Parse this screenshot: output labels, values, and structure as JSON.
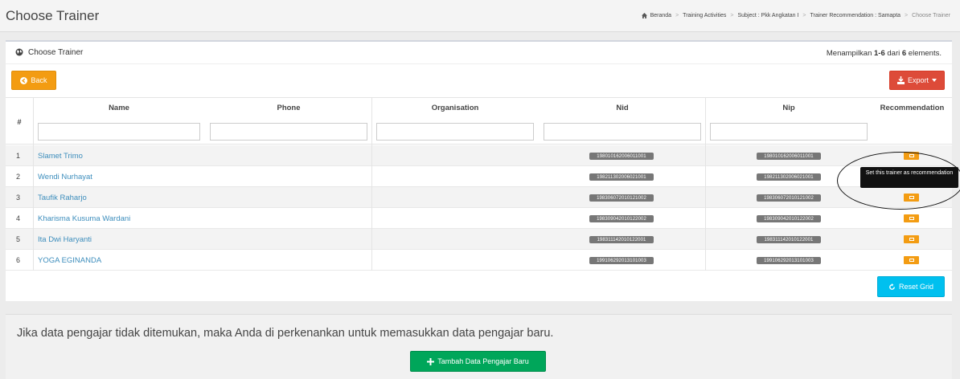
{
  "header": {
    "title": "Choose Trainer",
    "breadcrumb": [
      {
        "label": "Beranda",
        "icon": "home-icon"
      },
      {
        "label": "Training Activities"
      },
      {
        "label": "Subject : Pkk Angkatan I"
      },
      {
        "label": "Trainer Recommendation : Samapta"
      },
      {
        "label": "Choose Trainer"
      }
    ],
    "separator": ">"
  },
  "panel": {
    "title": "Choose Trainer",
    "summary_prefix": "Menampilkan ",
    "summary_range": "1-6",
    "summary_mid": " dari ",
    "summary_total": "6",
    "summary_suffix": " elements.",
    "back_label": "Back",
    "export_label": "Export",
    "reset_label": "Reset Grid"
  },
  "columns": {
    "num": "#",
    "name": "Name",
    "phone": "Phone",
    "organisation": "Organisation",
    "nid": "Nid",
    "nip": "Nip",
    "recommendation": "Recommendation"
  },
  "rows": [
    {
      "num": "1",
      "name": "Slamet Trimo",
      "nid": "198010162006011001",
      "nip": "198010162006011001"
    },
    {
      "num": "2",
      "name": "Wendi Nurhayat",
      "nid": "198211302006021001",
      "nip": "198211302006021001"
    },
    {
      "num": "3",
      "name": "Taufik Raharjo",
      "nid": "198306072010121002",
      "nip": "198306072010121002"
    },
    {
      "num": "4",
      "name": "Kharisma Kusuma Wardani",
      "nid": "198309042010122002",
      "nip": "198309042010122002"
    },
    {
      "num": "5",
      "name": "Ita Dwi Haryanti",
      "nid": "198311142010122001",
      "nip": "198311142010122001"
    },
    {
      "num": "6",
      "name": "YOGA EGINANDA",
      "nid": "199106292013101003",
      "nip": "199106292013101003"
    }
  ],
  "tooltip": "Set this trainer as recommendation",
  "info": {
    "text": "Jika data pengajar tidak ditemukan, maka Anda di perkenankan untuk memasukkan data pengajar baru.",
    "add_label": "Tambah Data Pengajar Baru"
  },
  "colors": {
    "back": "#f39c12",
    "export": "#dd4b39",
    "reset": "#00c0ef",
    "add": "#00a65a",
    "link": "#3c8dbc",
    "recommend": "#f39c12",
    "badge": "#777777"
  }
}
